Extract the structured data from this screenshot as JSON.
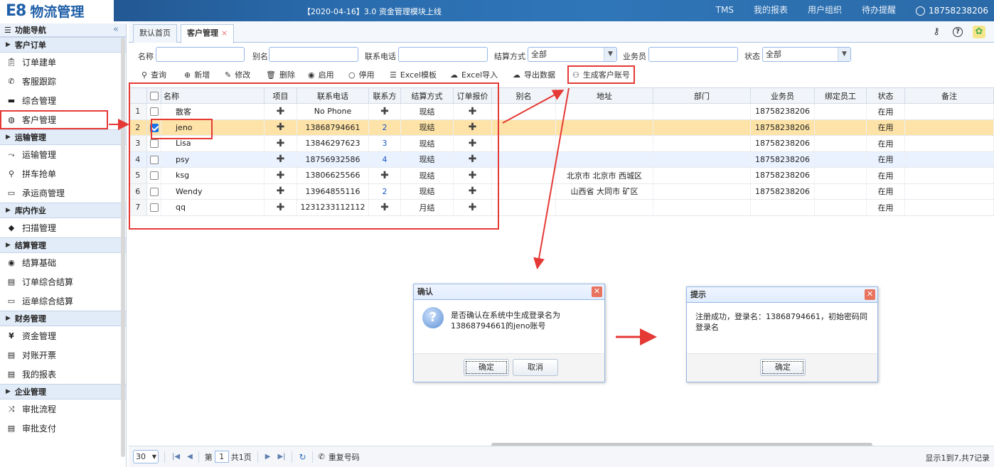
{
  "app": {
    "logo_mark": "E8",
    "logo_name": "物流管理",
    "notice": "【2020-04-16】3.0 资金管理模块上线"
  },
  "topnav": {
    "items": [
      "TMS",
      "我的报表",
      "用户组织",
      "待办提醒"
    ],
    "user": "18758238206"
  },
  "sidebar": {
    "header": "功能导航",
    "collapse_glyph": "«",
    "groups": [
      {
        "label": "客户订单",
        "items": [
          "订单建单",
          "客服跟踪",
          "综合管理",
          "客户管理"
        ]
      },
      {
        "label": "运输管理",
        "items": [
          "运输管理",
          "拼车抢单",
          "承运商管理"
        ]
      },
      {
        "label": "库内作业",
        "items": [
          "扫描管理"
        ]
      },
      {
        "label": "结算管理",
        "items": [
          "结算基础",
          "订单综合结算",
          "运单综合结算"
        ]
      },
      {
        "label": "财务管理",
        "items": [
          "资金管理",
          "对账开票",
          "我的报表"
        ]
      },
      {
        "label": "企业管理",
        "items": [
          "审批流程",
          "审批支付"
        ]
      }
    ]
  },
  "tabs": {
    "home": "默认首页",
    "current": "客户管理",
    "close": "×"
  },
  "filters": {
    "name": "名称",
    "alias": "别名",
    "phone": "联系电话",
    "settle": "结算方式",
    "settle_value": "全部",
    "sales": "业务员",
    "status": "状态",
    "status_value": "全部"
  },
  "toolbar": {
    "query": "查询",
    "add": "新增",
    "edit": "修改",
    "delete": "删除",
    "enable": "启用",
    "disable": "停用",
    "excel_tpl": "Excel模板",
    "excel_import": "Excel导入",
    "export": "导出数据",
    "generate": "生成客户账号"
  },
  "table": {
    "columns": [
      "名称",
      "项目",
      "联系电话",
      "联系方",
      "结算方式",
      "订单报价",
      "别名",
      "地址",
      "部门",
      "业务员",
      "绑定员工",
      "状态",
      "备注"
    ],
    "rows": [
      {
        "n": "1",
        "checked": false,
        "name": "散客",
        "phone": "No Phone",
        "contact": "",
        "settle": "现结",
        "address": "",
        "sales": "18758238206",
        "status": "在用"
      },
      {
        "n": "2",
        "checked": true,
        "name": "jeno",
        "phone": "13868794661",
        "contact": "2",
        "settle": "现结",
        "address": "",
        "sales": "18758238206",
        "status": "在用"
      },
      {
        "n": "3",
        "checked": false,
        "name": "Lisa",
        "phone": "13846297623",
        "contact": "3",
        "settle": "现结",
        "address": "",
        "sales": "18758238206",
        "status": "在用"
      },
      {
        "n": "4",
        "checked": false,
        "name": "psy",
        "phone": "18756932586",
        "contact": "4",
        "settle": "现结",
        "address": "",
        "sales": "18758238206",
        "status": "在用"
      },
      {
        "n": "5",
        "checked": false,
        "name": "ksg",
        "phone": "13806625566",
        "contact": "",
        "settle": "现结",
        "address": "北京市 北京市 西城区",
        "sales": "18758238206",
        "status": "在用"
      },
      {
        "n": "6",
        "checked": false,
        "name": "Wendy",
        "phone": "13964855116",
        "contact": "2",
        "settle": "现结",
        "address": "山西省 大同市 矿区",
        "sales": "18758238206",
        "status": "在用"
      },
      {
        "n": "7",
        "checked": false,
        "name": "qq",
        "phone": "1231233112112",
        "contact": "",
        "settle": "月结",
        "address": "",
        "sales": "",
        "status": "在用"
      }
    ]
  },
  "pager": {
    "size": "30",
    "page_prefix": "第",
    "page": "1",
    "page_suffix": "共1页",
    "redial": "重复号码",
    "info": "显示1到7,共7记录"
  },
  "confirm_dialog": {
    "title": "确认",
    "message": "是否确认在系统中生成登录名为13868794661的jeno账号",
    "ok": "确定",
    "cancel": "取消"
  },
  "tip_dialog": {
    "title": "提示",
    "message": "注册成功，登录名：13868794661，初始密码同登录名",
    "ok": "确定"
  },
  "colors": {
    "annotation": "#e53935",
    "selected_row": "#fde3a7",
    "header_blue": "#2a6cae"
  }
}
